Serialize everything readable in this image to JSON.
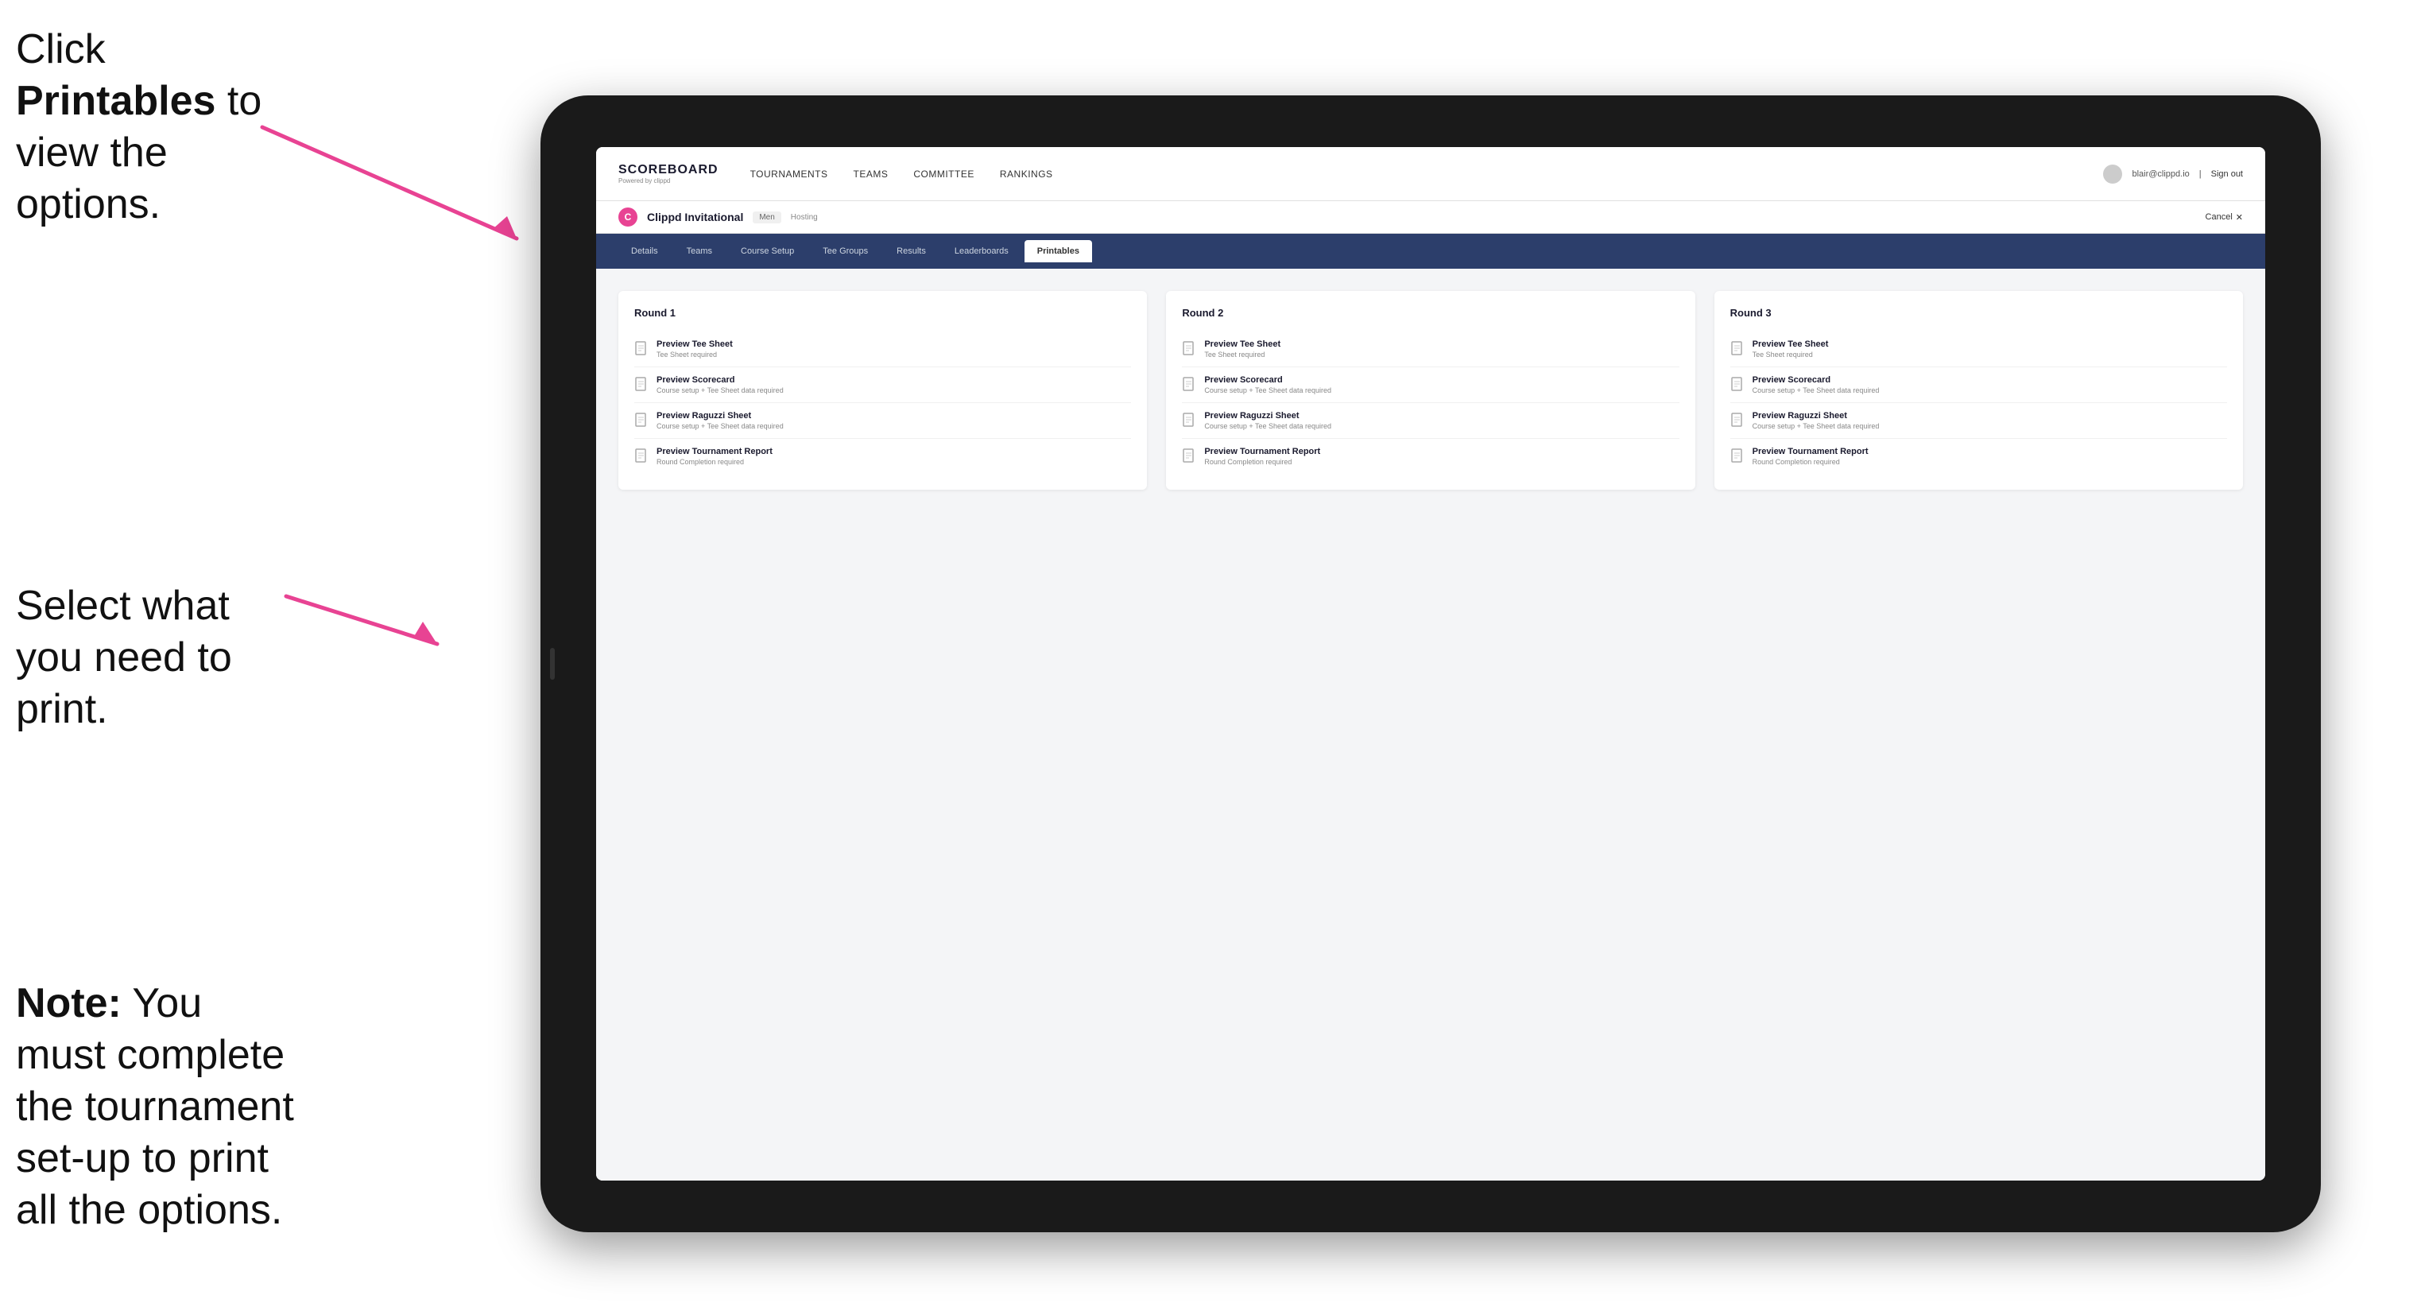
{
  "instructions": {
    "top_line1": "Click ",
    "top_bold": "Printables",
    "top_line2": " to",
    "top_line3": "view the options.",
    "mid_line1": "Select what you",
    "mid_line2": "need to print.",
    "bottom_bold": "Note:",
    "bottom_text": " You must complete the tournament set-up to print all the options."
  },
  "topNav": {
    "logo_title": "SCOREBOARD",
    "logo_sub": "Powered by clippd",
    "nav_items": [
      "TOURNAMENTS",
      "TEAMS",
      "COMMITTEE",
      "RANKINGS"
    ],
    "user_email": "blair@clippd.io",
    "sign_out": "Sign out"
  },
  "tournamentHeader": {
    "logo_letter": "C",
    "tournament_name": "Clippd Invitational",
    "badge": "Men",
    "status": "Hosting",
    "cancel": "Cancel",
    "cancel_x": "✕"
  },
  "subNav": {
    "tabs": [
      "Details",
      "Teams",
      "Course Setup",
      "Tee Groups",
      "Results",
      "Leaderboards",
      "Printables"
    ],
    "active": "Printables"
  },
  "rounds": [
    {
      "title": "Round 1",
      "items": [
        {
          "label": "Preview Tee Sheet",
          "sublabel": "Tee Sheet required"
        },
        {
          "label": "Preview Scorecard",
          "sublabel": "Course setup + Tee Sheet data required"
        },
        {
          "label": "Preview Raguzzi Sheet",
          "sublabel": "Course setup + Tee Sheet data required"
        },
        {
          "label": "Preview Tournament Report",
          "sublabel": "Round Completion required"
        }
      ]
    },
    {
      "title": "Round 2",
      "items": [
        {
          "label": "Preview Tee Sheet",
          "sublabel": "Tee Sheet required"
        },
        {
          "label": "Preview Scorecard",
          "sublabel": "Course setup + Tee Sheet data required"
        },
        {
          "label": "Preview Raguzzi Sheet",
          "sublabel": "Course setup + Tee Sheet data required"
        },
        {
          "label": "Preview Tournament Report",
          "sublabel": "Round Completion required"
        }
      ]
    },
    {
      "title": "Round 3",
      "items": [
        {
          "label": "Preview Tee Sheet",
          "sublabel": "Tee Sheet required"
        },
        {
          "label": "Preview Scorecard",
          "sublabel": "Course setup + Tee Sheet data required"
        },
        {
          "label": "Preview Raguzzi Sheet",
          "sublabel": "Course setup + Tee Sheet data required"
        },
        {
          "label": "Preview Tournament Report",
          "sublabel": "Round Completion required"
        }
      ]
    }
  ],
  "colors": {
    "accent": "#e84393",
    "nav_bg": "#2c3e6b",
    "active_tab_bg": "#ffffff"
  }
}
